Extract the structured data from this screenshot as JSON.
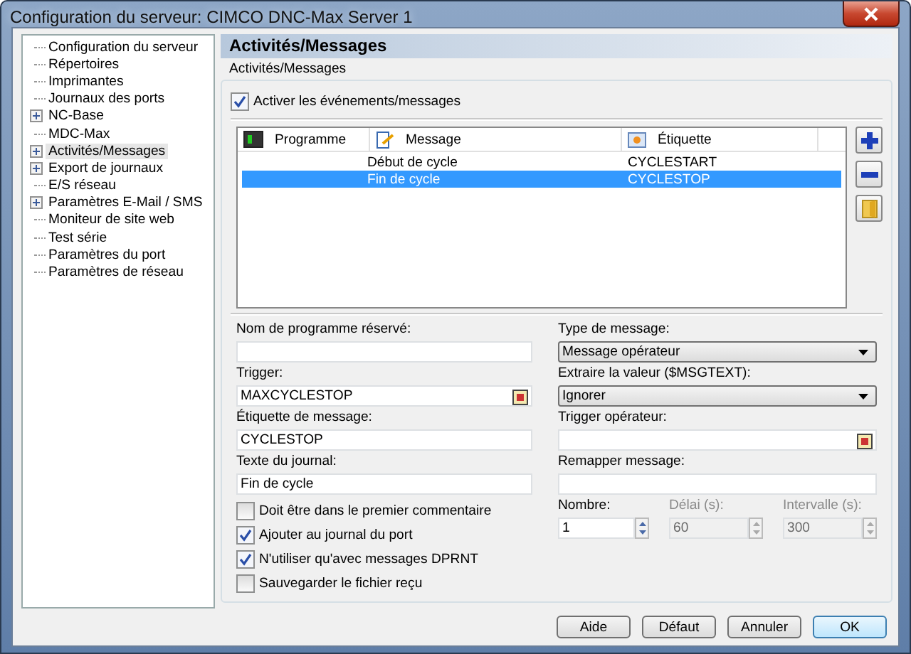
{
  "window": {
    "title": "Configuration du serveur: CIMCO DNC-Max Server 1"
  },
  "sidebar": {
    "items": [
      {
        "label": "Configuration du serveur",
        "expandable": false,
        "selected": false
      },
      {
        "label": "Répertoires",
        "expandable": false,
        "selected": false
      },
      {
        "label": "Imprimantes",
        "expandable": false,
        "selected": false
      },
      {
        "label": "Journaux des ports",
        "expandable": false,
        "selected": false
      },
      {
        "label": "NC-Base",
        "expandable": true,
        "selected": false
      },
      {
        "label": "MDC-Max",
        "expandable": false,
        "selected": false
      },
      {
        "label": "Activités/Messages",
        "expandable": true,
        "selected": true
      },
      {
        "label": "Export de journaux",
        "expandable": true,
        "selected": false
      },
      {
        "label": "E/S réseau",
        "expandable": false,
        "selected": false
      },
      {
        "label": "Paramètres E-Mail / SMS",
        "expandable": true,
        "selected": false
      },
      {
        "label": "Moniteur de site web",
        "expandable": false,
        "selected": false
      },
      {
        "label": "Test série",
        "expandable": false,
        "selected": false
      },
      {
        "label": "Paramètres du port",
        "expandable": false,
        "selected": false
      },
      {
        "label": "Paramètres de réseau",
        "expandable": false,
        "selected": false
      }
    ]
  },
  "panel": {
    "title": "Activités/Messages",
    "group_label": "Activités/Messages",
    "enable": {
      "label": "Activer les événements/messages",
      "checked": true
    }
  },
  "table": {
    "columns": [
      {
        "label": "Programme",
        "kind": "program"
      },
      {
        "label": "Message",
        "kind": "message"
      },
      {
        "label": "Étiquette",
        "kind": "tag"
      }
    ],
    "rows": [
      {
        "message": "Début de cycle",
        "tag": "CYCLESTART",
        "selected": false
      },
      {
        "message": "Fin de cycle",
        "tag": "CYCLESTOP",
        "selected": true
      }
    ]
  },
  "left_fields": [
    {
      "label": "Nom de programme réservé:",
      "kind": "text"
    },
    {
      "label": "Trigger:",
      "value": "MAXCYCLESTOP",
      "kind": "picker"
    },
    {
      "label": "Étiquette de message:",
      "value": "CYCLESTOP",
      "kind": "text"
    },
    {
      "label": "Texte du journal:",
      "value": "Fin de cycle",
      "kind": "text"
    }
  ],
  "checkboxes": [
    {
      "label": "Doit être dans le premier commentaire",
      "checked": false
    },
    {
      "label": "Ajouter au journal du port",
      "checked": true
    },
    {
      "label": "N'utiliser qu'avec messages DPRNT",
      "checked": true
    },
    {
      "label": "Sauvegarder le fichier reçu",
      "checked": false
    }
  ],
  "right_fields": [
    {
      "label": "Type de message:",
      "value": "Message opérateur",
      "kind": "select"
    },
    {
      "label": "Extraire la valeur ($MSGTEXT):",
      "value": "Ignorer",
      "kind": "select"
    },
    {
      "label": "Trigger opérateur:",
      "kind": "picker"
    },
    {
      "label": "Remapper message:",
      "kind": "text"
    }
  ],
  "spinners": [
    {
      "label": "Nombre:",
      "value": "1",
      "disabled": false
    },
    {
      "label": "Délai (s):",
      "value": "60",
      "disabled": true
    },
    {
      "label": "Intervalle (s):",
      "value": "300",
      "disabled": true
    }
  ],
  "buttons": [
    {
      "label": "Aide",
      "default": false
    },
    {
      "label": "Défaut",
      "default": false
    },
    {
      "label": "Annuler",
      "default": false
    },
    {
      "label": "OK",
      "default": true
    }
  ]
}
